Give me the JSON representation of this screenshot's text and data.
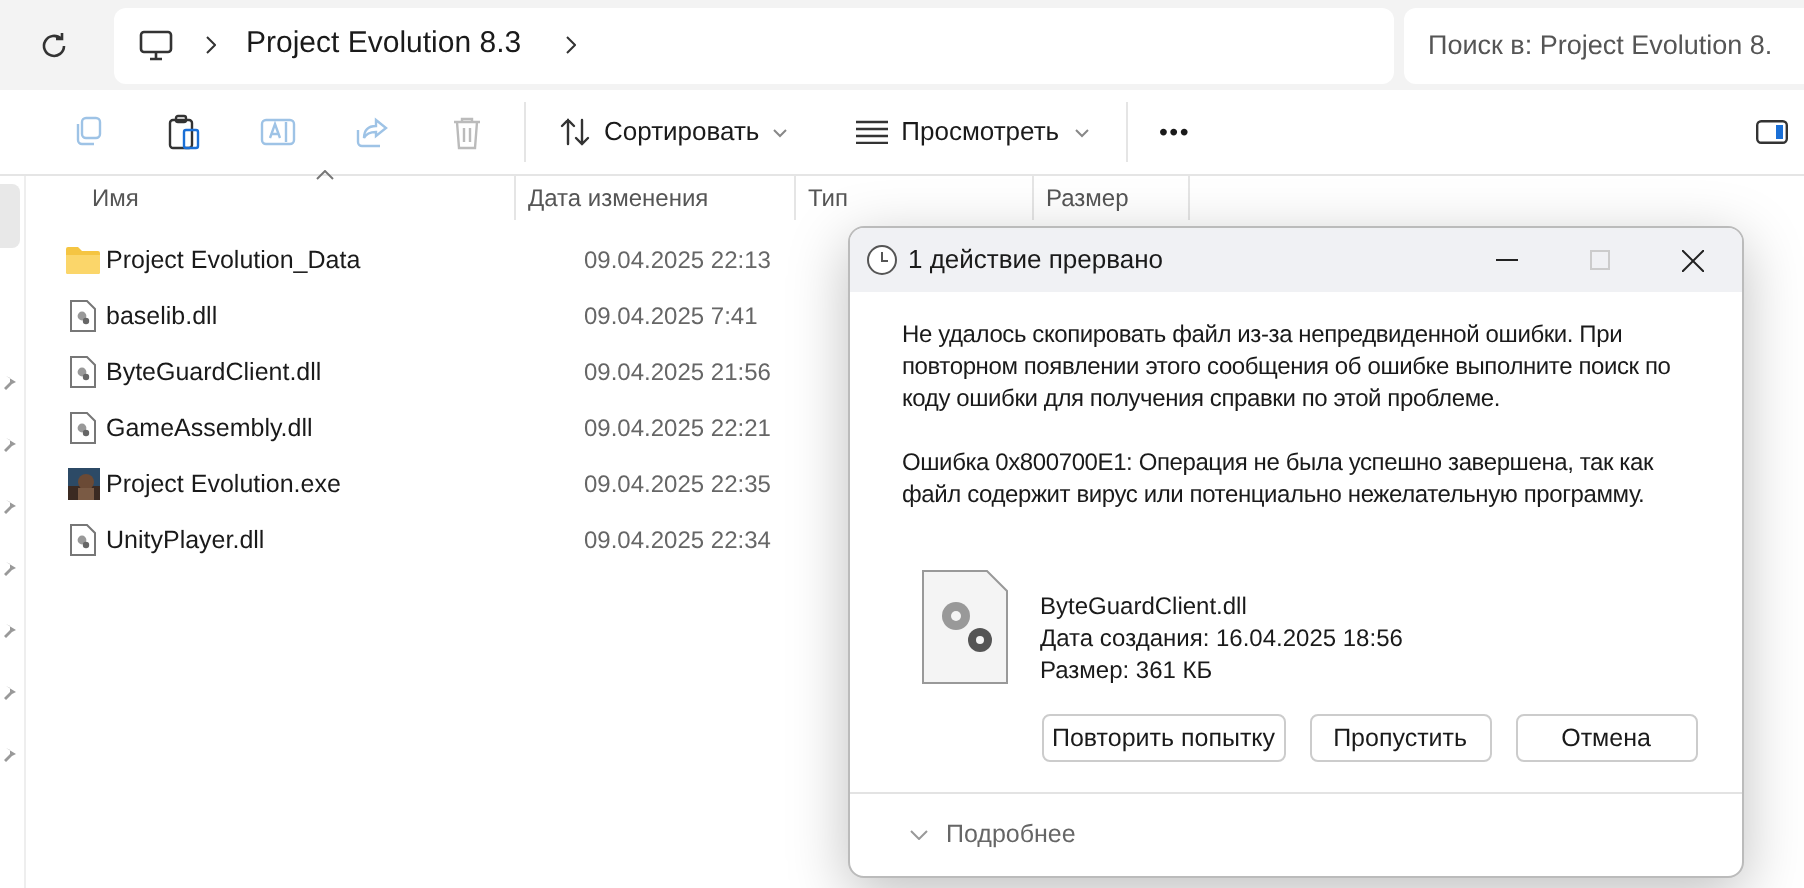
{
  "address_bar": {
    "path": "Project Evolution 8.3"
  },
  "search": {
    "placeholder": "Поиск в: Project Evolution 8."
  },
  "toolbar": {
    "sort": "Сортировать",
    "view": "Просмотреть",
    "more": "•••"
  },
  "table": {
    "columns": [
      "Имя",
      "Дата изменения",
      "Тип",
      "Размер"
    ],
    "rows": [
      {
        "kind": "folder",
        "name": "Project Evolution_Data",
        "date": "09.04.2025 22:13"
      },
      {
        "kind": "dll",
        "name": "baselib.dll",
        "date": "09.04.2025 7:41"
      },
      {
        "kind": "dll",
        "name": "ByteGuardClient.dll",
        "date": "09.04.2025 21:56"
      },
      {
        "kind": "dll",
        "name": "GameAssembly.dll",
        "date": "09.04.2025 22:21"
      },
      {
        "kind": "exe",
        "name": "Project Evolution.exe",
        "date": "09.04.2025 22:35"
      },
      {
        "kind": "dll",
        "name": "UnityPlayer.dll",
        "date": "09.04.2025 22:34"
      }
    ]
  },
  "dialog": {
    "title": "1 действие прервано",
    "message": "Не удалось скопировать файл из-за непредвиденной ошибки. При повторном появлении этого сообщения об ошибке выполните поиск по коду ошибки для получения справки по этой проблеме.",
    "error": "Ошибка 0x800700E1: Операция не была успешно завершена, так как файл содержит вирус или потенциально нежелательную программу.",
    "file": {
      "name": "ByteGuardClient.dll",
      "created": "Дата создания: 16.04.2025 18:56",
      "size": "Размер: 361 КБ"
    },
    "buttons": [
      "Повторить попытку",
      "Пропустить",
      "Отмена"
    ],
    "details": "Подробнее"
  }
}
